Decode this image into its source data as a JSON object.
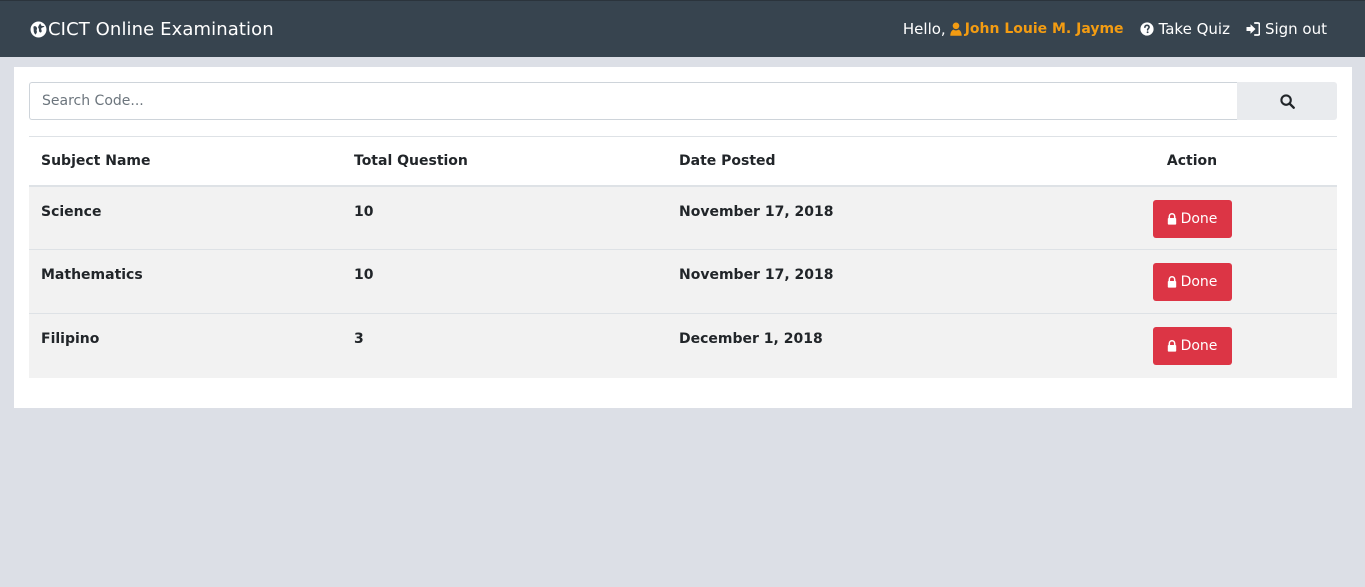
{
  "navbar": {
    "brand": "CICT Online Examination",
    "brand_icon": "globe-icon",
    "greeting": "Hello,",
    "user_name": "John Louie M. Jayme",
    "user_icon": "user-icon",
    "take_quiz": "Take Quiz",
    "take_quiz_icon": "question-circle-icon",
    "sign_out": "Sign out",
    "sign_out_icon": "sign-in-icon"
  },
  "colors": {
    "navbar_bg": "#37444f",
    "page_bg": "#dcdfe6",
    "user_name": "#f39c12",
    "done_button": "#dc3545",
    "row_bg": "#f2f2f2"
  },
  "search": {
    "placeholder": "Search Code...",
    "value": "",
    "button_icon": "search-icon"
  },
  "table": {
    "headers": [
      "Subject Name",
      "Total Question",
      "Date Posted",
      "Action"
    ],
    "rows": [
      {
        "subject": "Science",
        "total": "10",
        "date": "November 17, 2018",
        "action": "Done"
      },
      {
        "subject": "Mathematics",
        "total": "10",
        "date": "November 17, 2018",
        "action": "Done"
      },
      {
        "subject": "Filipino",
        "total": "3",
        "date": "December 1, 2018",
        "action": "Done"
      }
    ],
    "action_icon": "lock-icon"
  }
}
